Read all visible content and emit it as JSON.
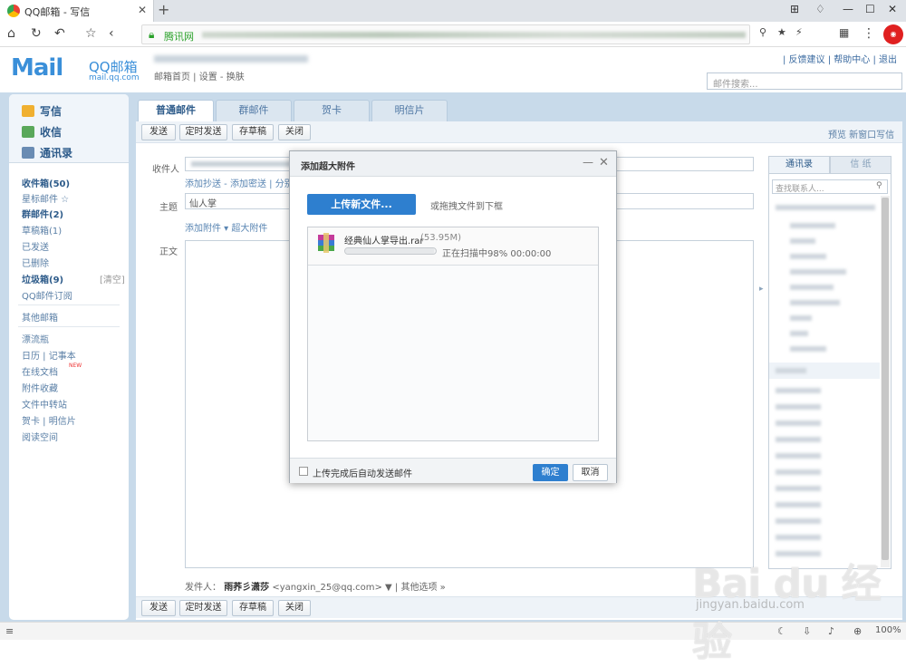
{
  "browser": {
    "tab_title": "QQ邮箱 - 写信",
    "site_label": "腾讯网",
    "zoom": "100%"
  },
  "header": {
    "logo_text": "Mail",
    "logo_name": "QQ邮箱",
    "logo_url": "mail.qq.com",
    "account_links": "邮箱首页 | 设置 - 换肤",
    "top_links": "| 反馈建议 | 帮助中心 | 退出",
    "search_placeholder": "邮件搜索..."
  },
  "sidebar": {
    "quick": [
      "写信",
      "收信",
      "通讯录"
    ],
    "folders": [
      {
        "label": "收件箱(50)",
        "bold": true
      },
      {
        "label": "星标邮件 ☆",
        "bold": false
      },
      {
        "label": "群邮件(2)",
        "bold": true
      },
      {
        "label": "草稿箱(1)",
        "bold": false
      },
      {
        "label": "已发送",
        "bold": false
      },
      {
        "label": "已删除",
        "bold": false
      },
      {
        "label": "垃圾箱(9)",
        "bold": true
      }
    ],
    "trash_clear": "[清空]",
    "subscribe": "QQ邮件订阅",
    "other": "其他邮箱",
    "apps": [
      "漂流瓶",
      "日历 | 记事本",
      "在线文档",
      "附件收藏",
      "文件中转站",
      "贺卡 | 明信片",
      "阅读空间"
    ],
    "new_badge": "NEW"
  },
  "composer": {
    "tabs": [
      "普通邮件",
      "群邮件",
      "贺卡",
      "明信片"
    ],
    "toolbar": [
      "发送",
      "定时发送",
      "存草稿",
      "关闭"
    ],
    "toolbar_right": "预览  新窗口写信",
    "to_label": "收件人",
    "cc_links": "添加抄送 - 添加密送 | 分别发送",
    "subject_label": "主题",
    "subject_value": "仙人掌",
    "attach_links": "添加附件 ▾   超大附件",
    "body_label": "正文",
    "sender_label": "发件人：",
    "sender_name": "雨荞彡潇莎",
    "sender_email": "<yangxin_25@qq.com>",
    "sender_more": "▼  |  其他选项 »"
  },
  "contacts": {
    "tab_contacts": "通讯录",
    "tab_letter": "信 纸",
    "search_placeholder": "查找联系人..."
  },
  "modal": {
    "title": "添加超大附件",
    "upload_button": "上传新文件...",
    "drag_hint": "或拖拽文件到下框",
    "file": {
      "name": "经典仙人掌导出.rar",
      "size": "(53.95M)",
      "status": "正在扫描中98%   00:00:00",
      "progress": 0.98
    },
    "auto_send_label": "上传完成后自动发送邮件",
    "ok": "确定",
    "cancel": "取消"
  },
  "watermark": {
    "line1": "Bai du 经验",
    "line2": "jingyan.baidu.com"
  }
}
